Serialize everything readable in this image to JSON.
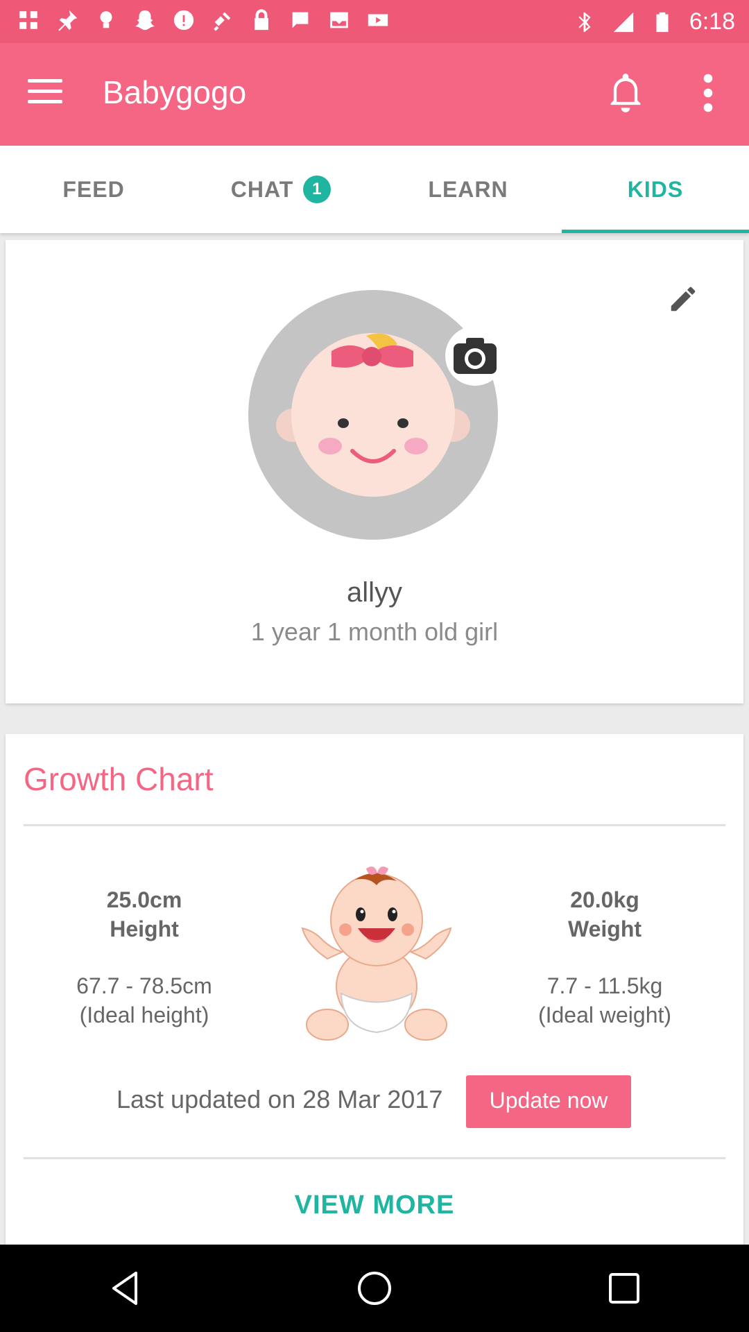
{
  "status_bar": {
    "time": "6:18",
    "icons": [
      "photos-icon",
      "pin-icon",
      "lightbulb-icon",
      "snap-icon",
      "alert-icon",
      "satellite-icon",
      "lock-icon",
      "chat-bubble-icon",
      "inbox-icon",
      "youtube-icon",
      "bluetooth-icon",
      "signal-icon",
      "battery-icon"
    ]
  },
  "app_bar": {
    "title": "Babygogo",
    "menu_icon": "hamburger-menu-icon",
    "bell_icon": "bell-icon",
    "more_icon": "more-vert-icon"
  },
  "tabs": [
    {
      "label": "FEED",
      "active": false
    },
    {
      "label": "CHAT",
      "badge": "1",
      "active": false
    },
    {
      "label": "LEARN",
      "active": false
    },
    {
      "label": "KIDS",
      "active": true
    }
  ],
  "profile": {
    "name": "allyy",
    "age": "1 year 1 month old girl"
  },
  "growth_chart": {
    "title": "Growth Chart",
    "height": {
      "value": "25.0cm",
      "label": "Height",
      "range": "67.7 - 78.5cm",
      "range_label": "(Ideal height)"
    },
    "weight": {
      "value": "20.0kg",
      "label": "Weight",
      "range": "7.7 - 11.5kg",
      "range_label": "(Ideal weight)"
    },
    "last_updated": "Last updated on 28 Mar 2017",
    "update_button": "Update now",
    "view_more": "VIEW MORE"
  },
  "colors": {
    "status_bar": "#ee5977",
    "app_bar": "#f46684",
    "accent": "#1fb5a0",
    "pink": "#f46684"
  }
}
